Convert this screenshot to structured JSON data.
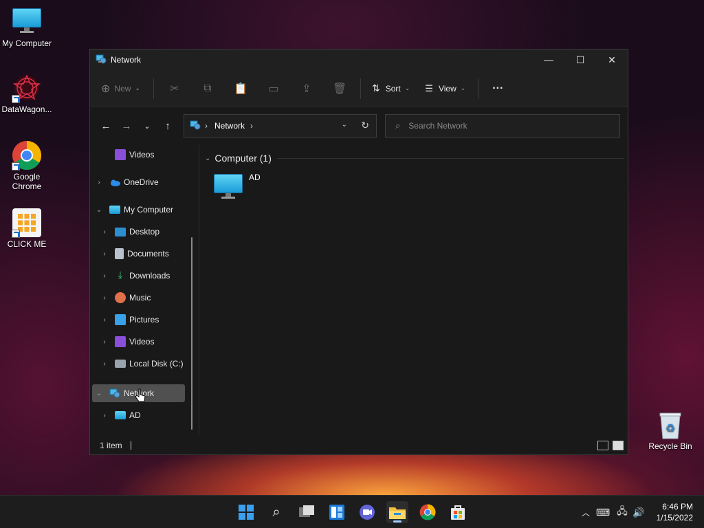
{
  "desktop": {
    "icons": [
      {
        "label": "My Computer"
      },
      {
        "label": "DataWagon..."
      },
      {
        "label": "Google Chrome"
      },
      {
        "label": "CLICK ME"
      },
      {
        "label": "Recycle Bin"
      }
    ]
  },
  "window": {
    "title": "Network",
    "controls": {
      "minimize": "—",
      "maximize": "☐",
      "close": "✕"
    }
  },
  "toolbar": {
    "new_label": "New",
    "sort_label": "Sort",
    "view_label": "View",
    "more_label": "···"
  },
  "address_bar": {
    "crumb": "Network",
    "separator": "›"
  },
  "search": {
    "placeholder": "Search Network"
  },
  "sidebar": {
    "items": [
      {
        "label": "Videos",
        "icon": "videos-icon"
      },
      {
        "label": "OneDrive",
        "icon": "onedrive-icon"
      },
      {
        "label": "My Computer",
        "icon": "computer-icon"
      },
      {
        "label": "Desktop",
        "icon": "desktop-folder-icon"
      },
      {
        "label": "Documents",
        "icon": "documents-icon"
      },
      {
        "label": "Downloads",
        "icon": "downloads-icon"
      },
      {
        "label": "Music",
        "icon": "music-icon"
      },
      {
        "label": "Pictures",
        "icon": "pictures-icon"
      },
      {
        "label": "Videos",
        "icon": "videos-icon"
      },
      {
        "label": "Local Disk (C:)",
        "icon": "disk-icon"
      },
      {
        "label": "Network",
        "icon": "network-icon",
        "selected": true
      },
      {
        "label": "AD",
        "icon": "computer-icon"
      }
    ]
  },
  "main": {
    "group_header": "Computer (1)",
    "items": [
      {
        "label": "AD",
        "icon": "computer-icon"
      }
    ]
  },
  "status": {
    "count": "1 item"
  },
  "taskbar": {
    "apps": [
      "start-icon",
      "search-icon",
      "task-view-icon",
      "widgets-icon",
      "teams-chat-icon",
      "file-explorer-icon",
      "chrome-icon",
      "store-icon"
    ],
    "clock": {
      "time": "6:46 PM",
      "date": "1/15/2022"
    }
  },
  "colors": {
    "window_bg": "#191919",
    "toolbar_bg": "#202020",
    "accent": "#9ad0ff",
    "selection": "#505050"
  }
}
